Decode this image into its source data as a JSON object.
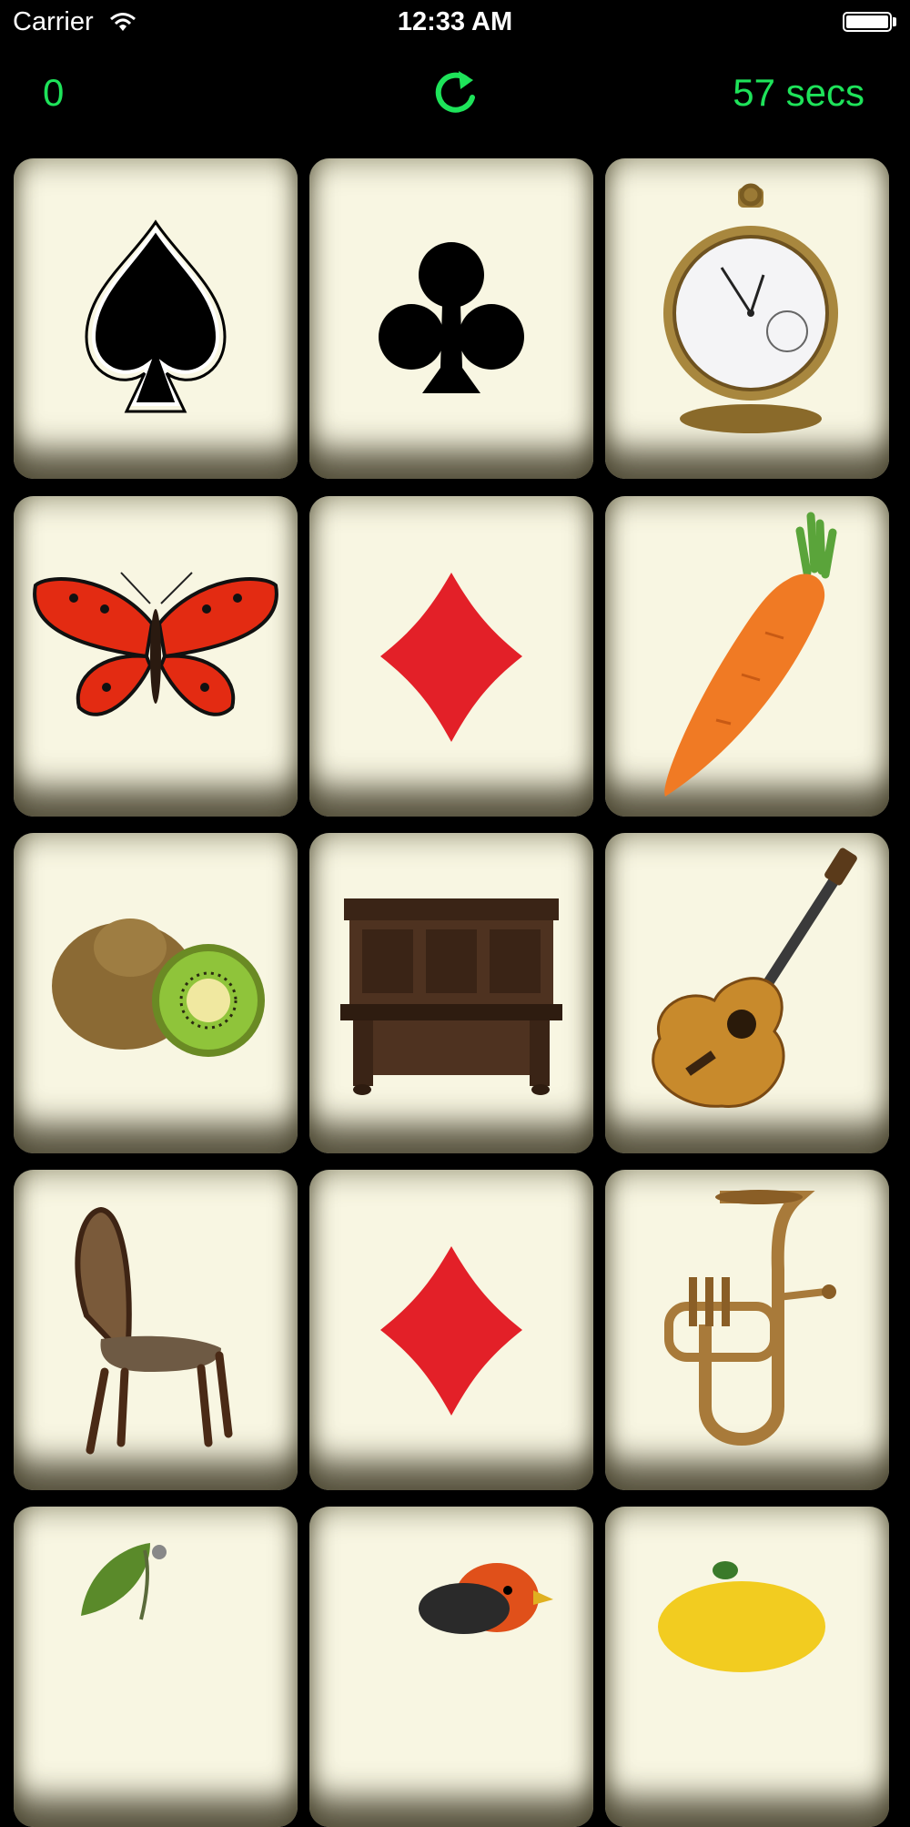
{
  "status_bar": {
    "carrier": "Carrier",
    "time": "12:33 AM"
  },
  "header": {
    "score": "0",
    "timer": "57 secs"
  },
  "colors": {
    "accent": "#1ee35a",
    "card_face": "#f8f6e2",
    "background": "#000000"
  },
  "cards": [
    {
      "icon": "spade-icon"
    },
    {
      "icon": "club-icon"
    },
    {
      "icon": "pocket-watch-icon"
    },
    {
      "icon": "butterfly-icon"
    },
    {
      "icon": "diamond-icon"
    },
    {
      "icon": "carrot-icon"
    },
    {
      "icon": "kiwi-icon"
    },
    {
      "icon": "antique-piano-icon"
    },
    {
      "icon": "guitar-icon"
    },
    {
      "icon": "chair-icon"
    },
    {
      "icon": "diamond-icon"
    },
    {
      "icon": "tuba-icon"
    },
    {
      "icon": "cherry-icon"
    },
    {
      "icon": "bird-icon"
    },
    {
      "icon": "lemon-icon"
    }
  ]
}
